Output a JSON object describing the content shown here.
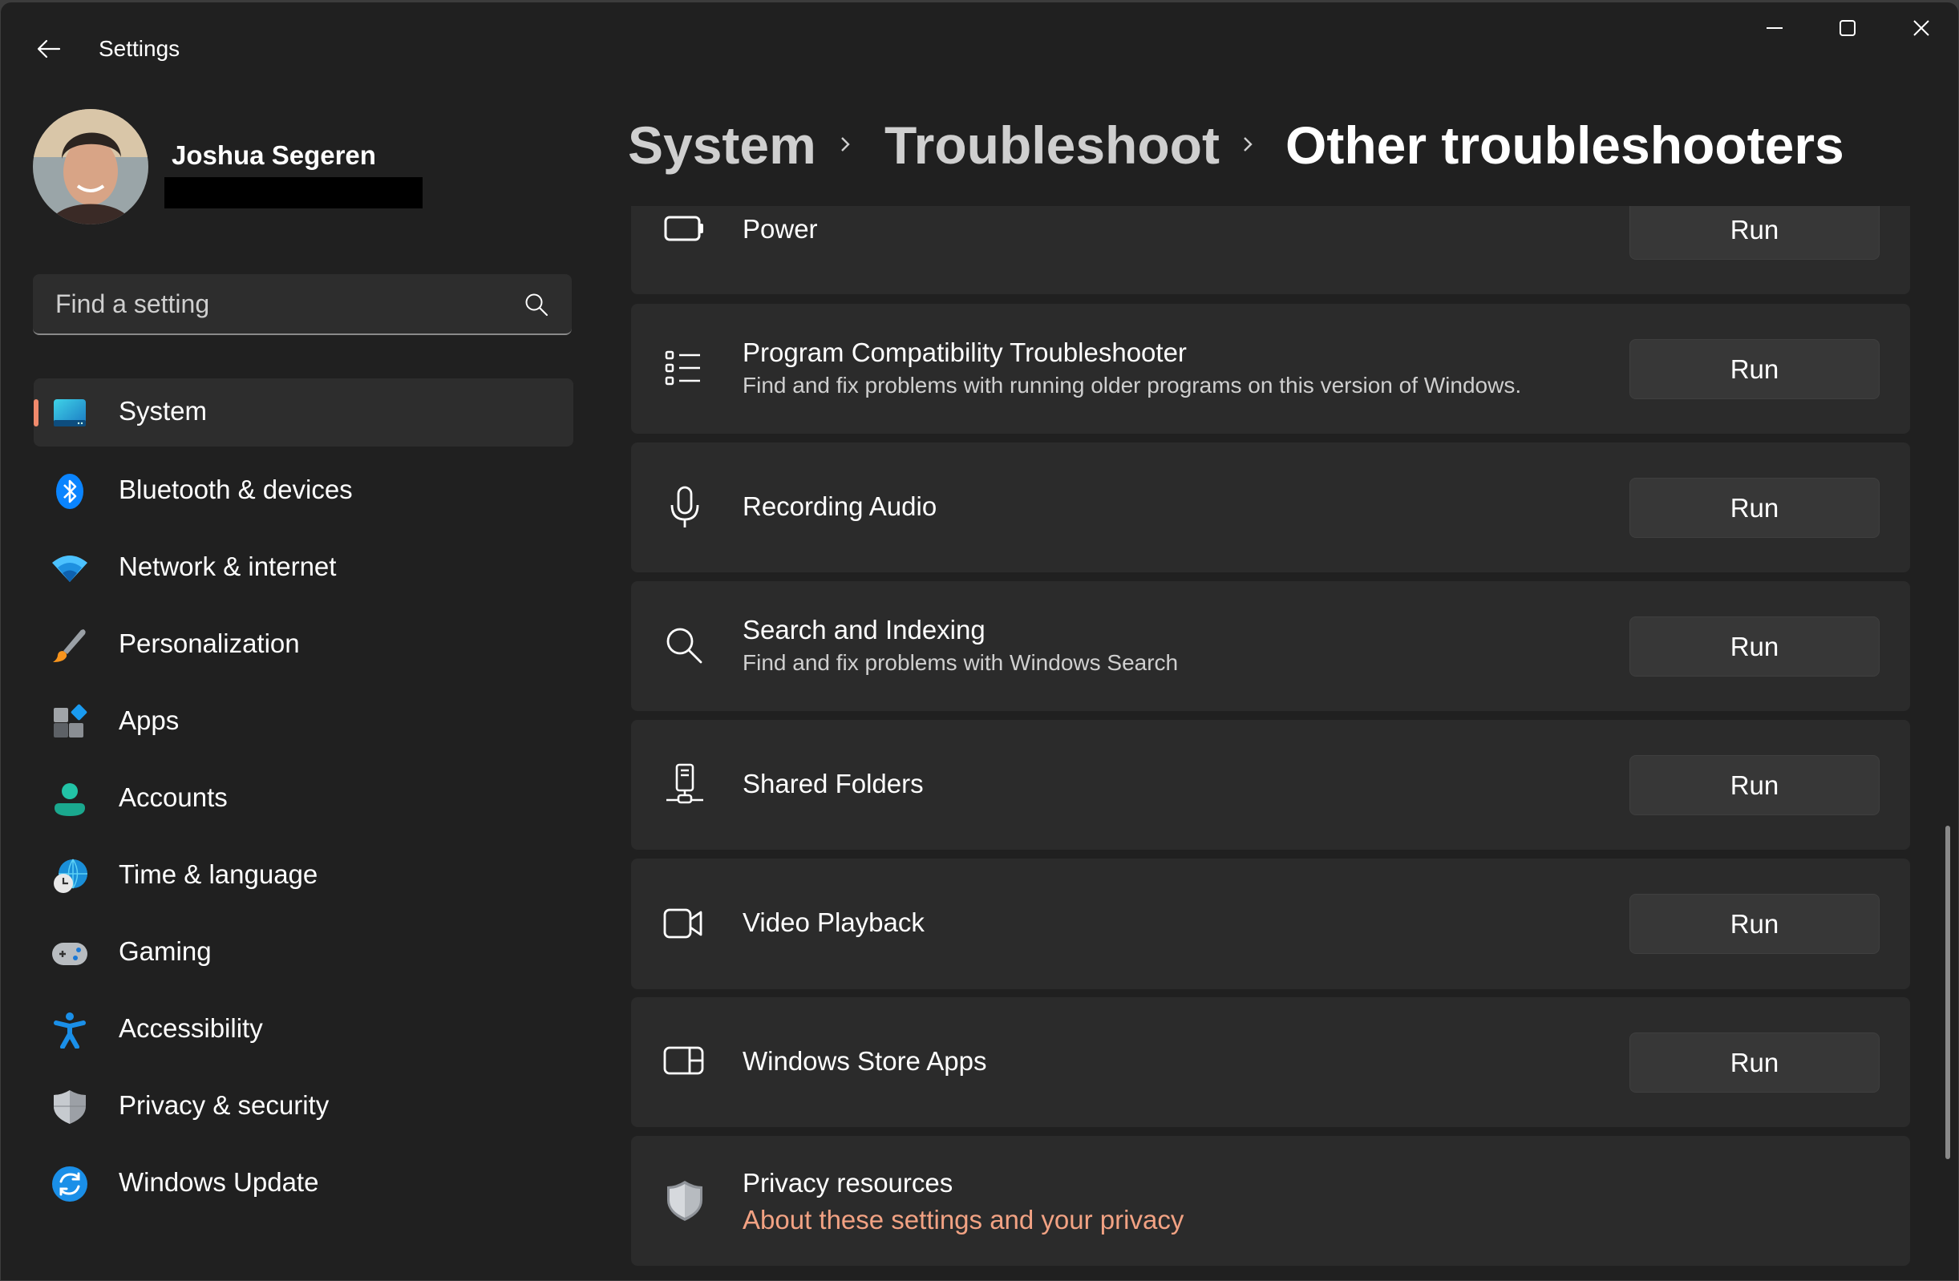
{
  "window": {
    "title": "Settings",
    "controls": {
      "minimize": "minimize-icon",
      "maximize": "maximize-icon",
      "close": "close-icon"
    }
  },
  "profile": {
    "name": "Joshua Segeren",
    "email_redacted": true
  },
  "search": {
    "placeholder": "Find a setting",
    "value": ""
  },
  "sidebar": {
    "items": [
      {
        "label": "System",
        "icon": "system-display-icon",
        "active": true
      },
      {
        "label": "Bluetooth & devices",
        "icon": "bluetooth-icon",
        "active": false
      },
      {
        "label": "Network & internet",
        "icon": "wifi-icon",
        "active": false
      },
      {
        "label": "Personalization",
        "icon": "paintbrush-icon",
        "active": false
      },
      {
        "label": "Apps",
        "icon": "apps-icon",
        "active": false
      },
      {
        "label": "Accounts",
        "icon": "person-icon",
        "active": false
      },
      {
        "label": "Time & language",
        "icon": "globe-clock-icon",
        "active": false
      },
      {
        "label": "Gaming",
        "icon": "gamepad-icon",
        "active": false
      },
      {
        "label": "Accessibility",
        "icon": "accessibility-icon",
        "active": false
      },
      {
        "label": "Privacy & security",
        "icon": "shield-icon",
        "active": false
      },
      {
        "label": "Windows Update",
        "icon": "update-icon",
        "active": false
      }
    ],
    "accent_color": "#f08a6c"
  },
  "breadcrumb": {
    "items": [
      "System",
      "Troubleshoot",
      "Other troubleshooters"
    ]
  },
  "troubleshooters": [
    {
      "title": "Power",
      "description": "",
      "icon": "battery-icon",
      "action": "Run"
    },
    {
      "title": "Program Compatibility Troubleshooter",
      "description": "Find and fix problems with running older programs on this version of Windows.",
      "icon": "list-icon",
      "action": "Run"
    },
    {
      "title": "Recording Audio",
      "description": "",
      "icon": "microphone-icon",
      "action": "Run"
    },
    {
      "title": "Search and Indexing",
      "description": "Find and fix problems with Windows Search",
      "icon": "search-icon",
      "action": "Run"
    },
    {
      "title": "Shared Folders",
      "description": "",
      "icon": "network-drive-icon",
      "action": "Run"
    },
    {
      "title": "Video Playback",
      "description": "",
      "icon": "video-camera-icon",
      "action": "Run"
    },
    {
      "title": "Windows Store Apps",
      "description": "",
      "icon": "store-apps-icon",
      "action": "Run"
    }
  ],
  "privacy_resources": {
    "title": "Privacy resources",
    "link": "About these settings and your privacy",
    "link_color": "#f2a283"
  }
}
